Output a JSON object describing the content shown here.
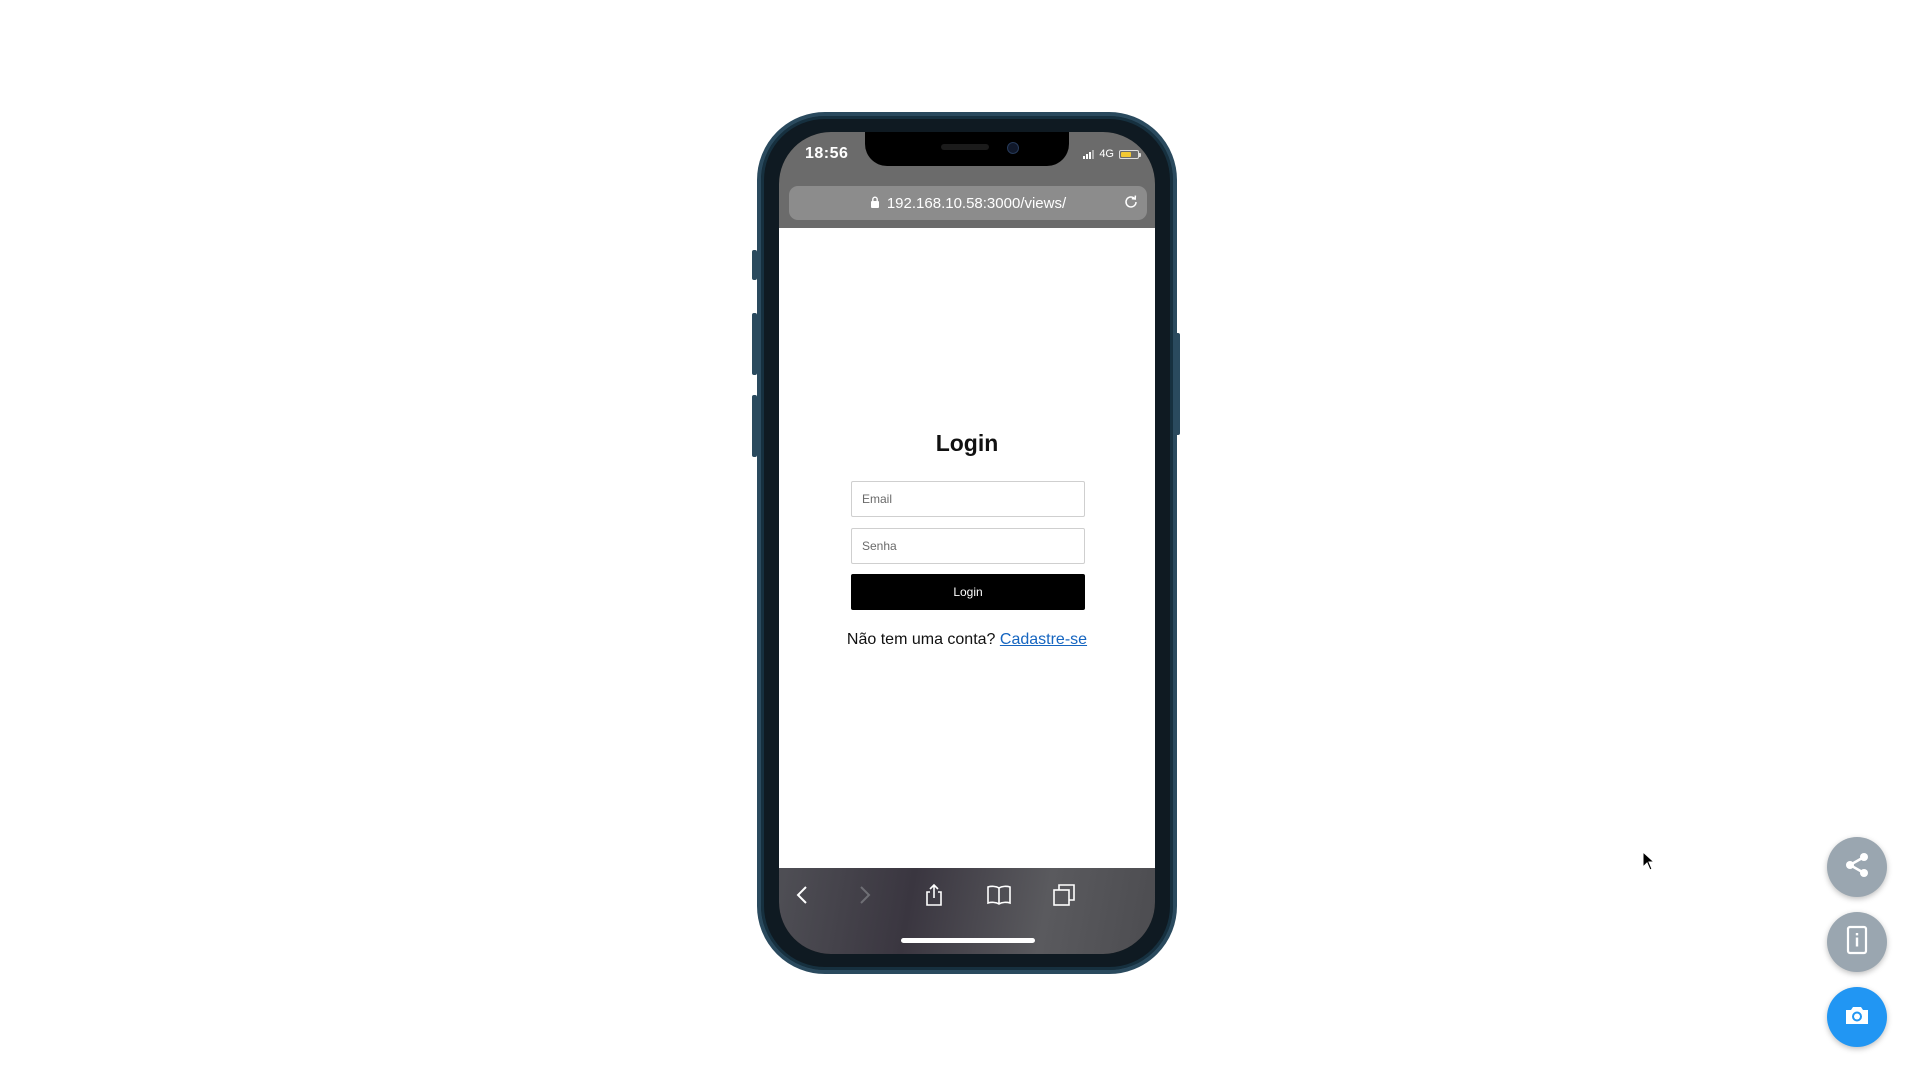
{
  "status_bar": {
    "time": "18:56",
    "network": "4G"
  },
  "address_bar": {
    "url": "192.168.10.58:3000/views/"
  },
  "login_form": {
    "title": "Login",
    "email_placeholder": "Email",
    "password_placeholder": "Senha",
    "submit_label": "Login",
    "signup_prompt": "Não tem uma conta?",
    "signup_link": "Cadastre-se"
  },
  "browser_toolbar": {
    "icons": [
      "back-icon",
      "forward-icon",
      "share-icon",
      "bookmarks-icon",
      "tabs-icon"
    ]
  },
  "floating_actions": {
    "icons": [
      "share-icon",
      "device-info-icon",
      "camera-icon"
    ],
    "camera_color": "#2196f3",
    "secondary_color": "#9aa6b0"
  },
  "colors": {
    "link": "#1565c0",
    "button": "#000000",
    "battery": "#f2c833"
  }
}
